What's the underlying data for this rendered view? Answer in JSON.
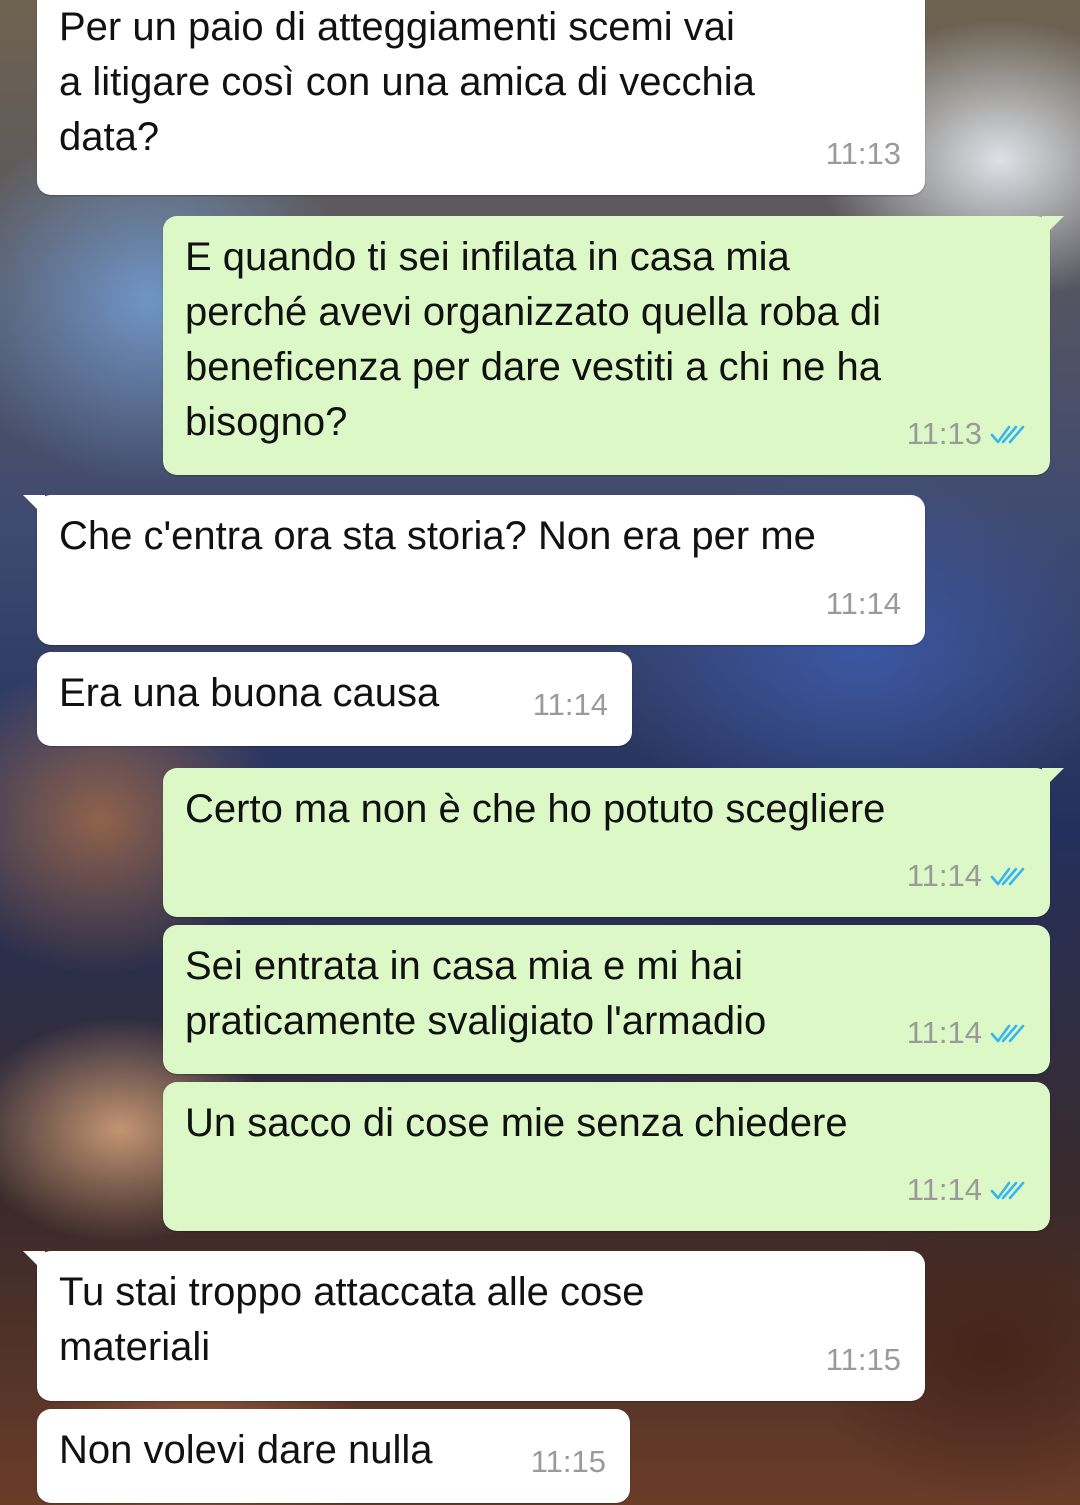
{
  "messages": [
    {
      "text": "Per un paio di atteggiamenti scemi vai\na litigare così con una amica di vecchia\ndata?",
      "time": "11:13",
      "direction": "incoming"
    },
    {
      "text": "E quando ti sei infilata in casa mia\nperché avevi organizzato quella roba di\nbeneficenza per dare vestiti a chi ne ha\nbisogno?",
      "time": "11:13",
      "direction": "outgoing",
      "status": "read"
    },
    {
      "text": "Che c'entra ora sta storia? Non era per me",
      "time": "11:14",
      "direction": "incoming"
    },
    {
      "text": "Era una buona causa",
      "time": "11:14",
      "direction": "incoming"
    },
    {
      "text": "Certo ma non è che ho potuto scegliere",
      "time": "11:14",
      "direction": "outgoing",
      "status": "read"
    },
    {
      "text": "Sei entrata in casa mia e mi hai\npraticamente svaligiato l'armadio",
      "time": "11:14",
      "direction": "outgoing",
      "status": "read"
    },
    {
      "text": "Un sacco di cose mie senza chiedere",
      "time": "11:14",
      "direction": "outgoing",
      "status": "read"
    },
    {
      "text": "Tu stai troppo attaccata alle cose\nmateriali",
      "time": "11:15",
      "direction": "incoming"
    },
    {
      "text": "Non volevi dare nulla",
      "time": "11:15",
      "direction": "incoming"
    }
  ],
  "colors": {
    "incoming_bubble": "#ffffff",
    "outgoing_bubble": "#dcf8c6",
    "read_ticks": "#34b7f1",
    "timestamp": "#9a9a9a"
  },
  "icons": {
    "read_receipt": "double-check-icon"
  }
}
